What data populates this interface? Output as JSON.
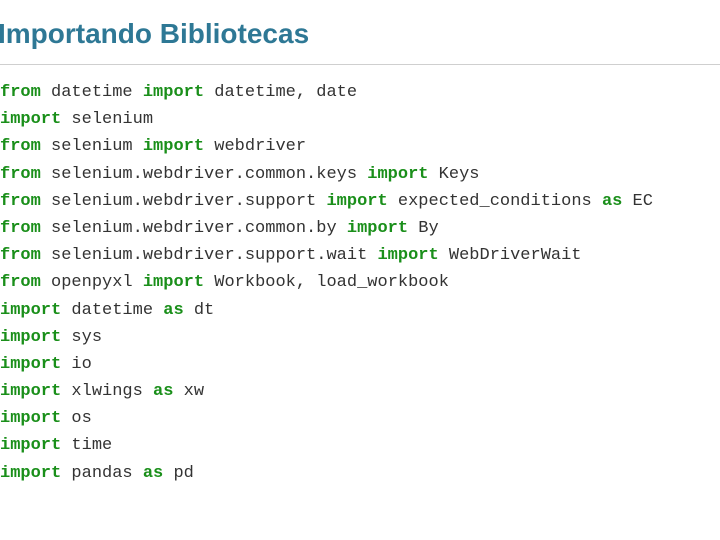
{
  "heading": "Importando Bibliotecas",
  "code_lines": [
    [
      {
        "t": "kw",
        "v": "from"
      },
      {
        "t": "txt",
        "v": " datetime "
      },
      {
        "t": "kw",
        "v": "import"
      },
      {
        "t": "txt",
        "v": " datetime, date"
      }
    ],
    [
      {
        "t": "kw",
        "v": "import"
      },
      {
        "t": "txt",
        "v": " selenium"
      }
    ],
    [
      {
        "t": "kw",
        "v": "from"
      },
      {
        "t": "txt",
        "v": " selenium "
      },
      {
        "t": "kw",
        "v": "import"
      },
      {
        "t": "txt",
        "v": " webdriver"
      }
    ],
    [
      {
        "t": "kw",
        "v": "from"
      },
      {
        "t": "txt",
        "v": " selenium.webdriver.common.keys "
      },
      {
        "t": "kw",
        "v": "import"
      },
      {
        "t": "txt",
        "v": " Keys"
      }
    ],
    [
      {
        "t": "kw",
        "v": "from"
      },
      {
        "t": "txt",
        "v": " selenium.webdriver.support "
      },
      {
        "t": "kw",
        "v": "import"
      },
      {
        "t": "txt",
        "v": " expected_conditions "
      },
      {
        "t": "kw",
        "v": "as"
      },
      {
        "t": "txt",
        "v": " EC"
      }
    ],
    [
      {
        "t": "kw",
        "v": "from"
      },
      {
        "t": "txt",
        "v": " selenium.webdriver.common.by "
      },
      {
        "t": "kw",
        "v": "import"
      },
      {
        "t": "txt",
        "v": " By"
      }
    ],
    [
      {
        "t": "kw",
        "v": "from"
      },
      {
        "t": "txt",
        "v": " selenium.webdriver.support.wait "
      },
      {
        "t": "kw",
        "v": "import"
      },
      {
        "t": "txt",
        "v": " WebDriverWait"
      }
    ],
    [
      {
        "t": "kw",
        "v": "from"
      },
      {
        "t": "txt",
        "v": " openpyxl "
      },
      {
        "t": "kw",
        "v": "import"
      },
      {
        "t": "txt",
        "v": " Workbook, load_workbook"
      }
    ],
    [
      {
        "t": "kw",
        "v": "import"
      },
      {
        "t": "txt",
        "v": " datetime "
      },
      {
        "t": "kw",
        "v": "as"
      },
      {
        "t": "txt",
        "v": " dt"
      }
    ],
    [
      {
        "t": "kw",
        "v": "import"
      },
      {
        "t": "txt",
        "v": " sys"
      }
    ],
    [
      {
        "t": "kw",
        "v": "import"
      },
      {
        "t": "txt",
        "v": " io"
      }
    ],
    [
      {
        "t": "kw",
        "v": "import"
      },
      {
        "t": "txt",
        "v": " xlwings "
      },
      {
        "t": "kw",
        "v": "as"
      },
      {
        "t": "txt",
        "v": " xw"
      }
    ],
    [
      {
        "t": "kw",
        "v": "import"
      },
      {
        "t": "txt",
        "v": " os"
      }
    ],
    [
      {
        "t": "kw",
        "v": "import"
      },
      {
        "t": "txt",
        "v": " time"
      }
    ],
    [
      {
        "t": "kw",
        "v": "import"
      },
      {
        "t": "txt",
        "v": " pandas "
      },
      {
        "t": "kw",
        "v": "as"
      },
      {
        "t": "txt",
        "v": " pd"
      }
    ]
  ]
}
